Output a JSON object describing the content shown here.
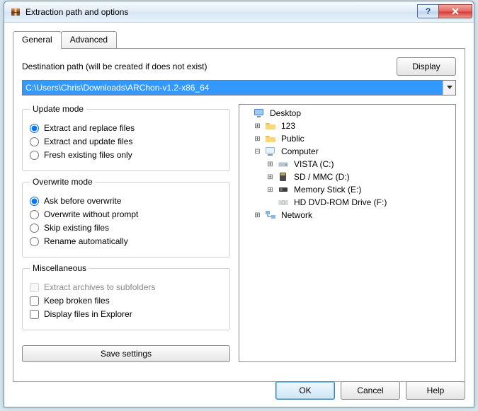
{
  "window": {
    "title": "Extraction path and options"
  },
  "tabs": {
    "general": "General",
    "advanced": "Advanced"
  },
  "destination": {
    "label": "Destination path (will be created if does not exist)",
    "value": "C:\\Users\\Chris\\Downloads\\ARChon-v1.2-x86_64",
    "display_btn": "Display"
  },
  "update_mode": {
    "legend": "Update mode",
    "opt_replace": "Extract and replace files",
    "opt_update": "Extract and update files",
    "opt_fresh": "Fresh existing files only"
  },
  "overwrite_mode": {
    "legend": "Overwrite mode",
    "opt_ask": "Ask before overwrite",
    "opt_without": "Overwrite without prompt",
    "opt_skip": "Skip existing files",
    "opt_rename": "Rename automatically"
  },
  "misc": {
    "legend": "Miscellaneous",
    "opt_subfolders": "Extract archives to subfolders",
    "opt_broken": "Keep broken files",
    "opt_explorer": "Display files in Explorer"
  },
  "save_settings": "Save settings",
  "tree": {
    "desktop": "Desktop",
    "folder_123": "123",
    "public": "Public",
    "computer": "Computer",
    "drive_c": "VISTA (C:)",
    "drive_d": "SD / MMC (D:)",
    "drive_e": "Memory Stick (E:)",
    "drive_f": "HD DVD-ROM Drive (F:)",
    "network": "Network"
  },
  "footer": {
    "ok": "OK",
    "cancel": "Cancel",
    "help": "Help"
  }
}
